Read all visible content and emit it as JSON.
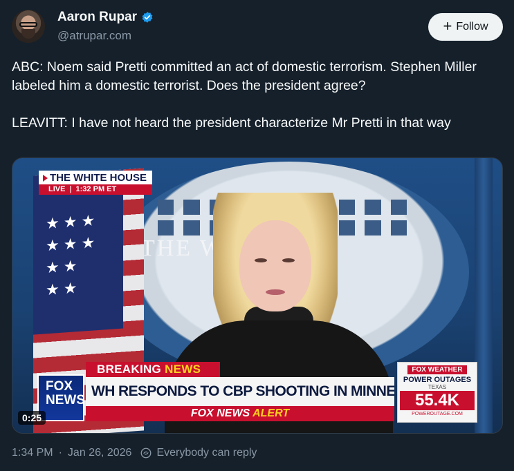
{
  "author": {
    "display_name": "Aaron Rupar",
    "handle": "@atrupar.com",
    "verified_color": "#1d9bf0"
  },
  "follow_button": {
    "label": "Follow",
    "icon": "plus-icon"
  },
  "post": {
    "paragraphs": [
      "ABC: Noem said Pretti committed an act of domestic terrorism. Stephen Miller labeled him a domestic terrorist. Does the president agree?",
      "LEAVITT: I have not heard the president characterize Mr Pretti in that way"
    ]
  },
  "video": {
    "wall_text": "THE W        HOUSE",
    "bug_title": "THE WHITE HOUSE",
    "bug_live": "LIVE",
    "bug_time": "1:32 PM ET",
    "breaking_label_1": "BREAKING",
    "breaking_label_2": "NEWS",
    "channel_logo_1": "FOX",
    "channel_logo_2": "NEWS",
    "headline": "WH RESPONDS TO CBP SHOOTING IN MINNEAPOLIS",
    "alert_1": "FOX NEWS",
    "alert_2": "ALERT",
    "weather_logo": "FOX WEATHER",
    "weather_title": "POWER OUTAGES",
    "weather_state": "TEXAS",
    "weather_value": "55.4K",
    "weather_site": "POWEROUTAGE.COM",
    "timecode": "0:25"
  },
  "footer": {
    "time": "1:34 PM",
    "date": "Jan 26, 2026",
    "reply_setting": "Everybody can reply",
    "reply_icon": "reply-settings-icon"
  },
  "colors": {
    "background": "#15202b",
    "muted_text": "#8b98a5",
    "accent": "#1d9bf0",
    "fox_red": "#c8102e"
  }
}
